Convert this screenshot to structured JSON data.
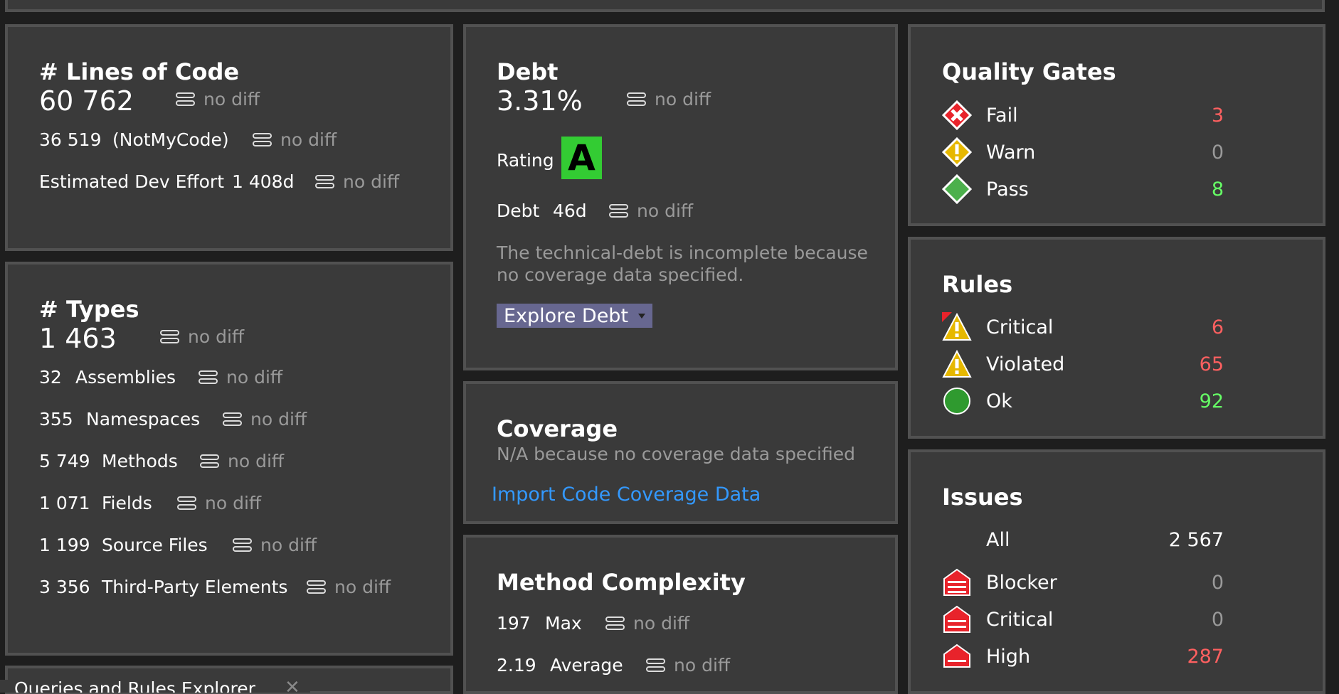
{
  "loc": {
    "title": "# Lines of Code",
    "value": "60 762",
    "diff": "no diff",
    "notmycode_value": "36 519",
    "notmycode_label": "(NotMyCode)",
    "notmycode_diff": "no diff",
    "effort_label": "Estimated Dev Effort",
    "effort_value": "1 408d",
    "effort_diff": "no diff"
  },
  "types": {
    "title": "# Types",
    "value": "1 463",
    "diff": "no diff",
    "rows": [
      {
        "value": "32",
        "label": "Assemblies",
        "diff": "no diff"
      },
      {
        "value": "355",
        "label": "Namespaces",
        "diff": "no diff"
      },
      {
        "value": "5 749",
        "label": "Methods",
        "diff": "no diff"
      },
      {
        "value": "1 071",
        "label": "Fields",
        "diff": "no diff"
      },
      {
        "value": "1 199",
        "label": "Source Files",
        "diff": "no diff"
      },
      {
        "value": "3 356",
        "label": "Third-Party Elements",
        "diff": "no diff"
      }
    ]
  },
  "debt": {
    "title": "Debt",
    "value": "3.31%",
    "diff": "no diff",
    "rating_label": "Rating",
    "rating": "A",
    "debt_label": "Debt",
    "debt_value": "46d",
    "debt_diff": "no diff",
    "note": "The technical-debt is incomplete because no coverage data specified.",
    "explore_button": "Explore Debt"
  },
  "coverage": {
    "title": "Coverage",
    "note": "N/A because no coverage data specified",
    "import_link": "Import Code Coverage Data"
  },
  "complexity": {
    "title": "Method Complexity",
    "rows": [
      {
        "value": "197",
        "label": "Max",
        "diff": "no diff"
      },
      {
        "value": "2.19",
        "label": "Average",
        "diff": "no diff"
      }
    ]
  },
  "quality_gates": {
    "title": "Quality Gates",
    "items": [
      {
        "label": "Fail",
        "count": "3",
        "icon": "fail-icon"
      },
      {
        "label": "Warn",
        "count": "0",
        "icon": "warn-icon"
      },
      {
        "label": "Pass",
        "count": "8",
        "icon": "pass-icon"
      }
    ]
  },
  "rules": {
    "title": "Rules",
    "items": [
      {
        "label": "Critical",
        "count": "6",
        "icon": "critical-rule-icon"
      },
      {
        "label": "Violated",
        "count": "65",
        "icon": "violated-rule-icon"
      },
      {
        "label": "Ok",
        "count": "92",
        "icon": "ok-rule-icon"
      }
    ]
  },
  "issues": {
    "title": "Issues",
    "items": [
      {
        "label": "All",
        "count": "2 567"
      },
      {
        "label": "Blocker",
        "count": "0",
        "icon": "blocker-issue-icon"
      },
      {
        "label": "Critical",
        "count": "0",
        "icon": "critical-issue-icon"
      },
      {
        "label": "High",
        "count": "287",
        "icon": "high-issue-icon"
      }
    ]
  },
  "bottom_tab": {
    "label": "Queries and Rules Explorer"
  },
  "colors": {
    "panel_bg": "#3a3a3a",
    "panel_border": "#515151",
    "rating_a": "#33cc33",
    "fail": "#ff6060",
    "pass": "#66ff66",
    "link": "#3399ff"
  }
}
